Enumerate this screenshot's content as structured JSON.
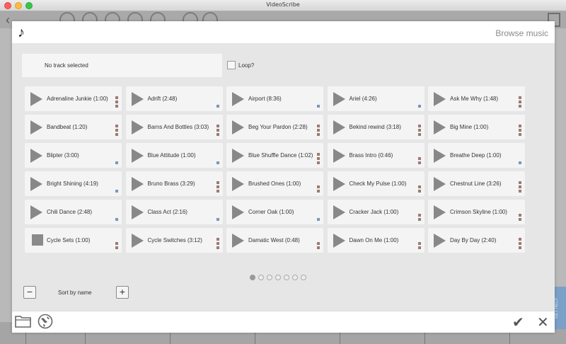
{
  "window": {
    "title": "VideoScribe"
  },
  "dialog": {
    "title": "Browse music"
  },
  "player": {
    "status": "No track selected",
    "loop_label": "Loop?",
    "loop_checked": false
  },
  "tracks": [
    {
      "label": "Adrenaline Junkie (1:00)",
      "marks": [
        "brown",
        "brown",
        "brown"
      ],
      "icon": "play-icon"
    },
    {
      "label": "Adrift (2:48)",
      "marks": [
        "blue"
      ],
      "icon": "play-icon"
    },
    {
      "label": "Airport (8:36)",
      "marks": [
        "blue"
      ],
      "icon": "play-icon"
    },
    {
      "label": "Ariel (4:26)",
      "marks": [
        "blue"
      ],
      "icon": "play-icon"
    },
    {
      "label": "Ask Me Why (1:48)",
      "marks": [
        "brown",
        "brown",
        "brown"
      ],
      "icon": "play-icon"
    },
    {
      "label": "Bandbeat (1:20)",
      "marks": [
        "brown",
        "brown",
        "brown"
      ],
      "icon": "play-icon"
    },
    {
      "label": "Barns And Bottles (3:03)",
      "marks": [
        "brown",
        "brown",
        "brown"
      ],
      "icon": "play-icon"
    },
    {
      "label": "Beg Your Pardon (2:28)",
      "marks": [
        "brown",
        "brown",
        "brown"
      ],
      "icon": "play-icon"
    },
    {
      "label": "Bekind rewind (3:18)",
      "marks": [
        "brown",
        "brown",
        "brown"
      ],
      "icon": "play-icon"
    },
    {
      "label": "Big Mine (1:00)",
      "marks": [
        "brown",
        "brown",
        "brown"
      ],
      "icon": "play-icon"
    },
    {
      "label": "Blipter (3:00)",
      "marks": [
        "blue"
      ],
      "icon": "play-icon"
    },
    {
      "label": "Blue Attitude (1:00)",
      "marks": [
        "blue"
      ],
      "icon": "play-icon"
    },
    {
      "label": "Blue Shuffle Dance (1:02)",
      "marks": [
        "brown",
        "brown",
        "brown"
      ],
      "icon": "play-icon"
    },
    {
      "label": "Brass Intro (0:46)",
      "marks": [
        "brown",
        "brown"
      ],
      "icon": "play-icon"
    },
    {
      "label": "Breathe Deep (1:00)",
      "marks": [
        "blue"
      ],
      "icon": "play-icon"
    },
    {
      "label": "Bright Shining (4:19)",
      "marks": [
        "blue"
      ],
      "icon": "play-icon"
    },
    {
      "label": "Bruno Brass (3:29)",
      "marks": [
        "brown",
        "brown",
        "brown"
      ],
      "icon": "play-icon"
    },
    {
      "label": "Brushed Ones (1:00)",
      "marks": [
        "brown",
        "brown"
      ],
      "icon": "play-icon"
    },
    {
      "label": "Check My Pulse (1:00)",
      "marks": [
        "brown",
        "brown"
      ],
      "icon": "play-icon"
    },
    {
      "label": "Chestnut Line (3:26)",
      "marks": [
        "brown",
        "brown",
        "brown"
      ],
      "icon": "play-icon"
    },
    {
      "label": "Chili Dance (2:48)",
      "marks": [
        "blue"
      ],
      "icon": "play-icon"
    },
    {
      "label": "Class Act (2:16)",
      "marks": [
        "blue"
      ],
      "icon": "play-icon"
    },
    {
      "label": "Corner Oak (1:00)",
      "marks": [
        "blue"
      ],
      "icon": "play-icon"
    },
    {
      "label": "Cracker Jack (1:00)",
      "marks": [
        "brown",
        "brown"
      ],
      "icon": "play-icon"
    },
    {
      "label": "Crimson Skyline (1:00)",
      "marks": [
        "brown",
        "brown"
      ],
      "icon": "play-icon"
    },
    {
      "label": "Cycle Sets (1:00)",
      "marks": [
        "brown",
        "brown"
      ],
      "icon": "stop-icon"
    },
    {
      "label": "Cycle Switches (3:12)",
      "marks": [
        "brown",
        "brown",
        "brown"
      ],
      "icon": "play-icon"
    },
    {
      "label": "Damatic West (0:48)",
      "marks": [
        "brown",
        "brown"
      ],
      "icon": "play-icon"
    },
    {
      "label": "Dawn On Me (1:00)",
      "marks": [
        "brown",
        "brown"
      ],
      "icon": "play-icon"
    },
    {
      "label": "Day By Day (2:40)",
      "marks": [
        "brown",
        "brown",
        "brown"
      ],
      "icon": "play-icon"
    }
  ],
  "pagination": {
    "pages": 7,
    "current": 1
  },
  "sort": {
    "label": "Sort by name"
  },
  "colors": {
    "mark_brown": "#9b7b73",
    "mark_blue": "#7b96b9",
    "tile_bg": "#f4f4f4",
    "panel_bg": "#e6e6e6"
  },
  "side_tab": {
    "label": "GET HELP"
  }
}
